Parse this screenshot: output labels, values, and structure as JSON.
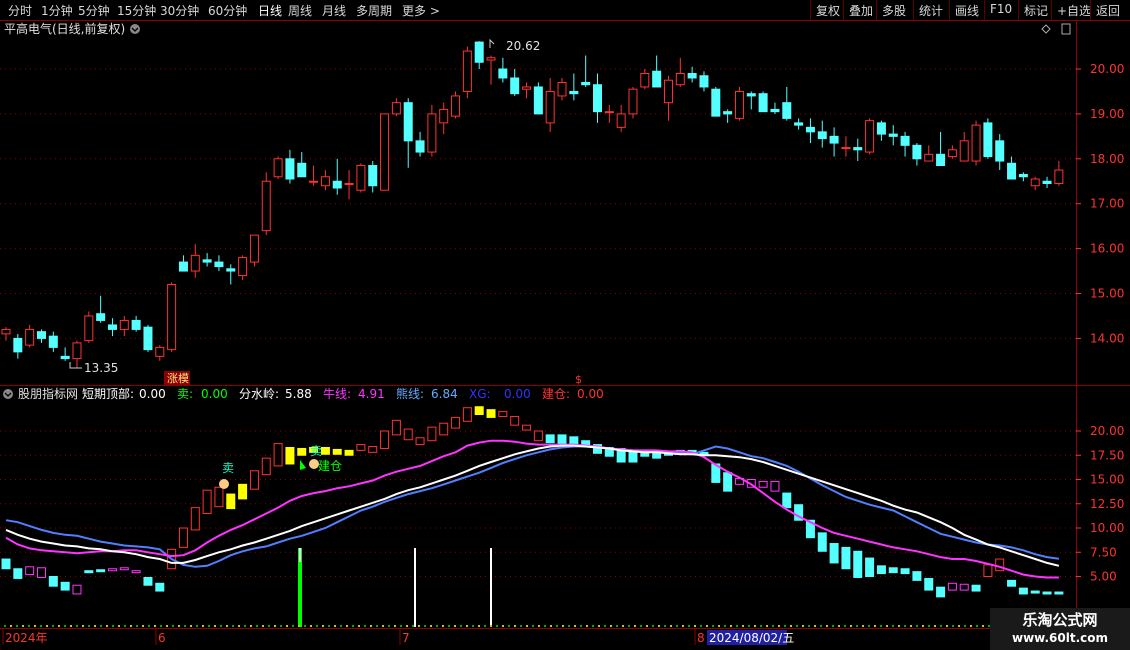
{
  "toolbar": {
    "periods": [
      "分时",
      "1分钟",
      "5分钟",
      "15分钟",
      "30分钟",
      "60分钟",
      "日线",
      "周线",
      "月线",
      "多周期",
      "更多 >"
    ],
    "active_period": "日线",
    "actions": [
      "复权",
      "叠加",
      "多股",
      "统计",
      "画线",
      "F10",
      "标记",
      "+自选",
      "返回"
    ]
  },
  "main_panel": {
    "title": "平高电气(日线,前复权)",
    "y_ticks": [
      "20.00",
      "19.00",
      "18.00",
      "17.00",
      "16.00",
      "15.00",
      "14.00"
    ],
    "high_label": "20.62",
    "low_label": "13.35",
    "limit_up_tag": "涨模",
    "dollar_tag": "$"
  },
  "indicator_panel": {
    "name": "股朋指标网",
    "params": [
      {
        "label": "短期顶部:",
        "value": "0.00",
        "color": "#ffffff"
      },
      {
        "label": "卖:",
        "value": "0.00",
        "color": "#00ff00"
      },
      {
        "label": "分水岭:",
        "value": "5.88",
        "color": "#ffffff"
      },
      {
        "label": "牛线:",
        "value": "4.91",
        "color": "#ff33ff"
      },
      {
        "label": "熊线:",
        "value": "6.84",
        "color": "#66aaff"
      },
      {
        "label": "XG:",
        "value": "0.00",
        "color": "#3333ff"
      },
      {
        "label": "建仓:",
        "value": "0.00",
        "color": "#ff3333"
      }
    ],
    "y_ticks": [
      "20.00",
      "17.50",
      "15.00",
      "12.50",
      "10.00",
      "7.50",
      "5.00"
    ],
    "sell_label": "卖",
    "sell_label2": "卖",
    "build_label": "建仓"
  },
  "time_axis": {
    "labels": [
      "2024年",
      "6",
      "7",
      "8"
    ],
    "cursor_date": "2024/08/02/五"
  },
  "watermark": {
    "line1": "乐淘公式网",
    "line2": "www.60lt.com"
  },
  "colors": {
    "up": "#ff3232",
    "down": "#54ffff",
    "border": "#8b0000",
    "bull": "#ff33ff",
    "bear": "#5080ff",
    "white": "#ffffff"
  },
  "chart_data": {
    "type": "candlestick",
    "candles": [
      [
        14.1,
        14.25,
        13.95,
        14.2
      ],
      [
        14.0,
        14.1,
        13.55,
        13.7
      ],
      [
        13.85,
        14.3,
        13.8,
        14.2
      ],
      [
        14.15,
        14.2,
        13.9,
        14.0
      ],
      [
        14.05,
        14.15,
        13.7,
        13.8
      ],
      [
        13.6,
        13.8,
        13.5,
        13.55
      ],
      [
        13.55,
        13.95,
        13.35,
        13.9
      ],
      [
        13.95,
        14.6,
        13.9,
        14.5
      ],
      [
        14.55,
        14.95,
        14.35,
        14.4
      ],
      [
        14.3,
        14.45,
        14.05,
        14.2
      ],
      [
        14.2,
        14.5,
        14.05,
        14.4
      ],
      [
        14.4,
        14.5,
        14.15,
        14.2
      ],
      [
        14.25,
        14.3,
        13.7,
        13.75
      ],
      [
        13.6,
        13.85,
        13.5,
        13.8
      ],
      [
        13.75,
        15.25,
        13.7,
        15.2
      ],
      [
        15.7,
        15.85,
        15.5,
        15.5
      ],
      [
        15.5,
        16.1,
        15.35,
        15.85
      ],
      [
        15.75,
        15.9,
        15.6,
        15.7
      ],
      [
        15.7,
        15.85,
        15.5,
        15.6
      ],
      [
        15.55,
        15.65,
        15.2,
        15.5
      ],
      [
        15.4,
        15.85,
        15.3,
        15.8
      ],
      [
        15.7,
        16.3,
        15.6,
        16.3
      ],
      [
        16.4,
        17.7,
        16.3,
        17.5
      ],
      [
        17.6,
        18.05,
        17.55,
        18.0
      ],
      [
        18.0,
        18.2,
        17.45,
        17.55
      ],
      [
        17.9,
        18.15,
        17.6,
        17.6
      ],
      [
        17.5,
        17.85,
        17.4,
        17.5
      ],
      [
        17.4,
        17.75,
        17.3,
        17.6
      ],
      [
        17.5,
        18.0,
        17.2,
        17.35
      ],
      [
        17.45,
        17.75,
        17.1,
        17.45
      ],
      [
        17.3,
        17.9,
        17.25,
        17.85
      ],
      [
        17.85,
        17.95,
        17.25,
        17.4
      ],
      [
        17.3,
        19.0,
        17.3,
        19.0
      ],
      [
        19.0,
        19.35,
        18.95,
        19.25
      ],
      [
        19.25,
        19.35,
        17.8,
        18.4
      ],
      [
        18.4,
        18.6,
        18.05,
        18.15
      ],
      [
        18.15,
        19.2,
        18.05,
        19.0
      ],
      [
        18.8,
        19.25,
        18.55,
        19.1
      ],
      [
        18.95,
        19.5,
        18.9,
        19.4
      ],
      [
        19.5,
        20.5,
        19.35,
        20.4
      ],
      [
        20.6,
        20.62,
        20.0,
        20.15
      ],
      [
        20.2,
        20.3,
        19.65,
        20.25
      ],
      [
        20.0,
        20.25,
        19.7,
        19.8
      ],
      [
        19.8,
        20.0,
        19.4,
        19.45
      ],
      [
        19.55,
        19.7,
        19.35,
        19.6
      ],
      [
        19.6,
        19.7,
        19.0,
        19.0
      ],
      [
        18.8,
        19.8,
        18.6,
        19.5
      ],
      [
        19.4,
        19.8,
        19.3,
        19.7
      ],
      [
        19.5,
        19.9,
        19.3,
        19.45
      ],
      [
        19.7,
        20.3,
        19.6,
        19.65
      ],
      [
        19.65,
        19.9,
        18.8,
        19.05
      ],
      [
        19.05,
        19.2,
        18.8,
        19.05
      ],
      [
        18.7,
        19.2,
        18.6,
        19.0
      ],
      [
        19.0,
        19.6,
        18.9,
        19.55
      ],
      [
        19.6,
        20.0,
        19.55,
        19.9
      ],
      [
        19.95,
        20.3,
        19.8,
        19.6
      ],
      [
        19.25,
        19.85,
        18.85,
        19.75
      ],
      [
        19.65,
        20.25,
        19.6,
        19.9
      ],
      [
        19.9,
        20.05,
        19.7,
        19.8
      ],
      [
        19.85,
        19.95,
        19.5,
        19.6
      ],
      [
        19.55,
        19.6,
        18.95,
        18.95
      ],
      [
        19.05,
        19.1,
        18.8,
        19.0
      ],
      [
        18.9,
        19.6,
        18.85,
        19.5
      ],
      [
        19.45,
        19.5,
        19.1,
        19.4
      ],
      [
        19.45,
        19.5,
        19.05,
        19.05
      ],
      [
        19.1,
        19.25,
        19.0,
        19.05
      ],
      [
        19.25,
        19.6,
        18.85,
        18.9
      ],
      [
        18.8,
        18.9,
        18.65,
        18.75
      ],
      [
        18.7,
        18.9,
        18.35,
        18.6
      ],
      [
        18.6,
        18.85,
        18.25,
        18.45
      ],
      [
        18.5,
        18.7,
        18.05,
        18.35
      ],
      [
        18.25,
        18.5,
        18.05,
        18.25
      ],
      [
        18.25,
        18.45,
        17.95,
        18.2
      ],
      [
        18.15,
        18.9,
        18.1,
        18.85
      ],
      [
        18.8,
        18.85,
        18.4,
        18.55
      ],
      [
        18.55,
        18.75,
        18.3,
        18.5
      ],
      [
        18.5,
        18.6,
        18.05,
        18.3
      ],
      [
        18.3,
        18.35,
        17.85,
        18.0
      ],
      [
        17.95,
        18.3,
        17.95,
        18.1
      ],
      [
        18.1,
        18.6,
        17.9,
        17.85
      ],
      [
        18.05,
        18.3,
        18.0,
        18.2
      ],
      [
        17.95,
        18.6,
        17.95,
        18.4
      ],
      [
        17.95,
        18.85,
        17.85,
        18.75
      ],
      [
        18.8,
        18.9,
        18.0,
        18.05
      ],
      [
        18.4,
        18.55,
        17.75,
        17.95
      ],
      [
        17.9,
        18.05,
        17.55,
        17.55
      ],
      [
        17.65,
        17.7,
        17.5,
        17.6
      ],
      [
        17.4,
        17.6,
        17.3,
        17.55
      ],
      [
        17.5,
        17.6,
        17.35,
        17.45
      ],
      [
        17.45,
        17.95,
        17.4,
        17.75
      ]
    ],
    "ind_lines": {
      "white": [
        9.8,
        9.3,
        8.9,
        8.6,
        8.4,
        8.2,
        8.1,
        7.9,
        7.8,
        7.6,
        7.5,
        7.3,
        7.0,
        6.8,
        6.4,
        6.4,
        6.7,
        7.1,
        7.5,
        7.8,
        8.2,
        8.5,
        8.9,
        9.3,
        9.7,
        10.2,
        10.6,
        11.0,
        11.4,
        11.8,
        12.2,
        12.6,
        13.0,
        13.5,
        13.9,
        14.2,
        14.6,
        15.0,
        15.4,
        15.9,
        16.4,
        16.8,
        17.2,
        17.6,
        17.9,
        18.2,
        18.4,
        18.5,
        18.5,
        18.4,
        18.3,
        18.2,
        18.0,
        17.9,
        17.8,
        17.8,
        17.7,
        17.6,
        17.6,
        17.5,
        17.5,
        17.4,
        17.3,
        17.1,
        16.8,
        16.4,
        16.0,
        15.6,
        15.2,
        14.8,
        14.4,
        14.0,
        13.6,
        13.2,
        12.8,
        12.3,
        11.9,
        11.6,
        11.1,
        10.6,
        10.0,
        9.3,
        8.8,
        8.3,
        8.0,
        7.6,
        7.2,
        6.8,
        6.4,
        6.1
      ],
      "bull": [
        9.0,
        8.3,
        7.9,
        7.7,
        7.6,
        7.5,
        7.4,
        7.5,
        7.6,
        7.6,
        7.7,
        7.7,
        7.5,
        7.3,
        7.1,
        7.2,
        7.7,
        8.5,
        9.2,
        9.8,
        10.3,
        10.9,
        11.5,
        12.1,
        12.8,
        13.3,
        13.6,
        13.8,
        14.1,
        14.3,
        14.6,
        14.9,
        15.4,
        15.8,
        16.1,
        16.4,
        16.9,
        17.4,
        17.8,
        18.5,
        18.8,
        19.0,
        19.0,
        18.9,
        18.7,
        18.6,
        18.6,
        18.6,
        18.6,
        18.5,
        18.4,
        18.2,
        18.1,
        18.0,
        18.0,
        18.0,
        17.9,
        17.9,
        17.8,
        17.3,
        16.5,
        15.8,
        15.2,
        14.5,
        13.6,
        12.7,
        11.9,
        11.2,
        10.6,
        10.0,
        9.5,
        9.2,
        8.9,
        8.6,
        8.3,
        8.0,
        7.8,
        7.6,
        7.3,
        7.0,
        6.8,
        6.8,
        6.6,
        6.3,
        6.0,
        5.6,
        5.2,
        5.0,
        4.9,
        4.9
      ],
      "bear": [
        10.8,
        10.6,
        10.2,
        9.8,
        9.5,
        9.3,
        9.2,
        8.9,
        8.6,
        8.4,
        8.2,
        8.1,
        8.0,
        7.8,
        6.8,
        6.2,
        6.0,
        6.1,
        6.6,
        7.2,
        7.6,
        7.9,
        8.1,
        8.5,
        8.9,
        9.2,
        9.6,
        10.0,
        10.6,
        11.2,
        11.8,
        12.2,
        12.7,
        13.1,
        13.5,
        13.8,
        14.1,
        14.5,
        14.9,
        15.3,
        15.7,
        16.2,
        16.7,
        17.1,
        17.5,
        17.8,
        18.1,
        18.3,
        18.4,
        18.4,
        18.3,
        18.2,
        18.1,
        18.0,
        17.9,
        17.9,
        17.9,
        17.8,
        17.6,
        18.0,
        18.4,
        18.2,
        17.8,
        17.4,
        17.2,
        16.8,
        16.4,
        15.8,
        15.1,
        14.4,
        13.8,
        13.2,
        12.8,
        12.4,
        12.1,
        11.8,
        11.2,
        10.6,
        10.0,
        9.4,
        9.1,
        8.8,
        8.5,
        8.3,
        8.2,
        8.0,
        7.7,
        7.3,
        7.0,
        6.84
      ]
    }
  }
}
